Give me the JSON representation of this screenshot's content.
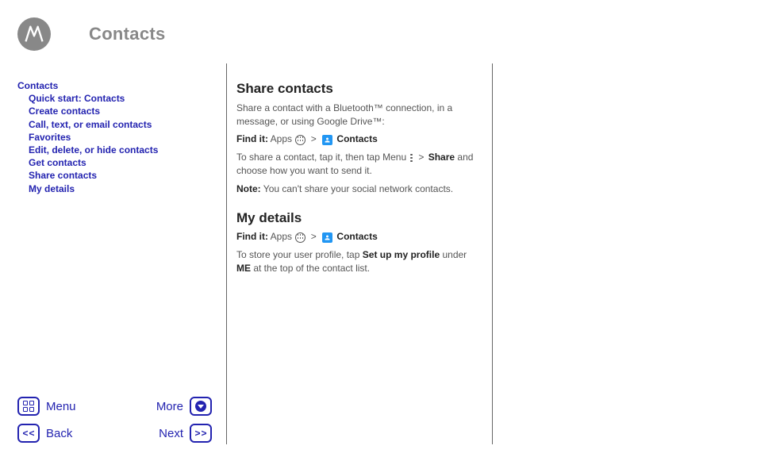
{
  "header": {
    "title": "Contacts"
  },
  "toc": {
    "items": [
      {
        "label": "Contacts",
        "level": 1
      },
      {
        "label": "Quick start: Contacts",
        "level": 2
      },
      {
        "label": "Create contacts",
        "level": 2
      },
      {
        "label": "Call, text, or email contacts",
        "level": 2
      },
      {
        "label": "Favorites",
        "level": 2
      },
      {
        "label": "Edit, delete, or hide contacts",
        "level": 2
      },
      {
        "label": "Get contacts",
        "level": 2
      },
      {
        "label": "Share contacts",
        "level": 2
      },
      {
        "label": "My details",
        "level": 2
      }
    ]
  },
  "content": {
    "section1": {
      "heading": "Share contacts",
      "intro": "Share a contact with a Bluetooth™ connection, in a message, or using Google Drive™:",
      "findit_label": "Find it:",
      "findit_apps": "Apps",
      "findit_contacts": "Contacts",
      "body_a": "To share a contact, tap it, then tap Menu",
      "body_b": "and choose how you want to send it.",
      "share_label": "Share",
      "note_label": "Note:",
      "note_body": "You can't share your social network contacts."
    },
    "section2": {
      "heading": "My details",
      "findit_label": "Find it:",
      "findit_apps": "Apps",
      "findit_contacts": "Contacts",
      "body_a": "To store your user profile, tap",
      "setup_label": "Set up my profile",
      "body_b": "under",
      "me_label": "ME",
      "body_c": "at the top of the contact list."
    }
  },
  "nav": {
    "menu": "Menu",
    "more": "More",
    "back": "Back",
    "next": "Next"
  }
}
